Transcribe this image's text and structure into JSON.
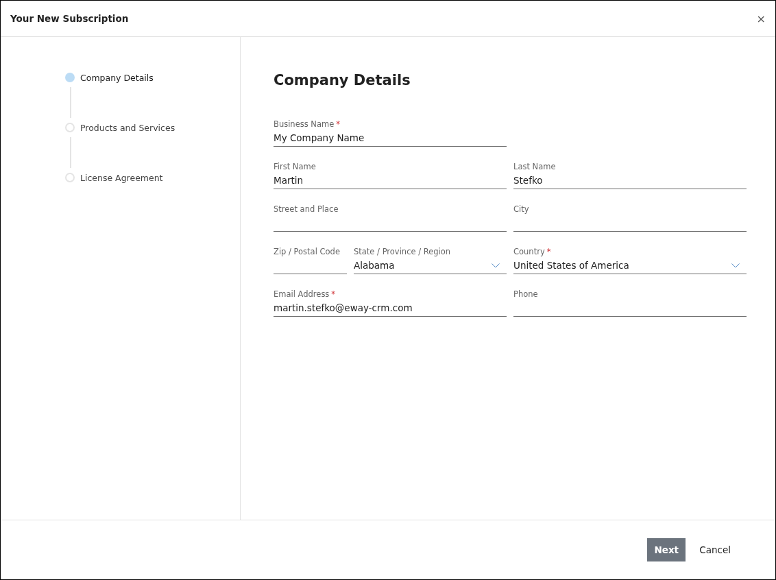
{
  "dialog": {
    "title": "Your New Subscription",
    "close_glyph": "×"
  },
  "steps": [
    {
      "label": "Company Details",
      "selected": true
    },
    {
      "label": "Products and Services",
      "selected": false
    },
    {
      "label": "License Agreement",
      "selected": false
    }
  ],
  "form": {
    "heading": "Company Details",
    "rows": [
      [
        {
          "kind": "text",
          "label": "Business Name",
          "required_mark": "*",
          "value": "My Company Name"
        }
      ],
      [
        {
          "kind": "text",
          "label": "First Name",
          "value": "Martin"
        },
        {
          "kind": "text",
          "label": "Last Name",
          "value": "Stefko"
        }
      ],
      [
        {
          "kind": "text",
          "label": "Street and Place"
        },
        {
          "kind": "text",
          "label": "City"
        }
      ],
      [
        {
          "kind": "text",
          "label": "Zip / Postal Code"
        },
        {
          "kind": "select",
          "label": "State / Province / Region",
          "value": "Alabama"
        },
        {
          "kind": "select",
          "label": "Country",
          "required_mark": "*",
          "value": "United States of America"
        }
      ],
      [
        {
          "kind": "text",
          "label": "Email Address",
          "required_mark": "*",
          "value": "martin.stefko@eway-crm.com"
        },
        {
          "kind": "text",
          "label": "Phone"
        }
      ]
    ]
  },
  "buttons": [
    {
      "kind": "primary",
      "label": "Next"
    },
    {
      "kind": "plain",
      "label": "Cancel"
    }
  ]
}
